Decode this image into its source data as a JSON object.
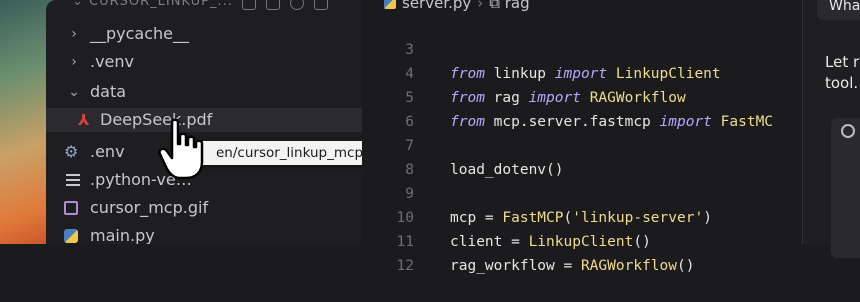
{
  "explorer": {
    "header_title": "CURSOR_LINKUP_...",
    "items": [
      {
        "label": "__pycache__",
        "type": "folder",
        "expanded": false
      },
      {
        "label": ".venv",
        "type": "folder",
        "expanded": false
      },
      {
        "label": "data",
        "type": "folder",
        "expanded": true
      },
      {
        "label": "DeepSeek.pdf",
        "type": "pdf",
        "selected": true
      },
      {
        "label": ".env",
        "type": "env"
      },
      {
        "label": ".python-ve…",
        "type": "text"
      },
      {
        "label": "cursor_mcp.gif",
        "type": "image"
      },
      {
        "label": "main.py",
        "type": "python"
      }
    ]
  },
  "tooltip": {
    "text": "en/cursor_linkup_mcp/data/DeepSeek.pdf"
  },
  "editor": {
    "tab_file": "server.py",
    "tab_symbol": "rag",
    "lines": [
      {
        "n": "3",
        "kw1": "from",
        "mod": " linkup ",
        "kw2": "import",
        "name": " LinkupClient"
      },
      {
        "n": "4",
        "kw1": "from",
        "mod": " rag ",
        "kw2": "import",
        "name": " RAGWorkflow"
      },
      {
        "n": "5",
        "kw1": "from",
        "mod": " mcp.server.fastmcp ",
        "kw2": "import",
        "name": " FastMC"
      },
      {
        "n": "6"
      },
      {
        "n": "7",
        "code": "load_dotenv()"
      },
      {
        "n": "8"
      },
      {
        "n": "9",
        "code_a": "mcp = ",
        "fn": "FastMCP",
        "code_b": "(",
        "str": "'linkup-server'",
        "code_c": ")"
      },
      {
        "n": "10",
        "code_a": "client = ",
        "fn": "LinkupClient",
        "code_b": "()"
      },
      {
        "n": "11",
        "code_a": "rag_workflow = ",
        "fn": "RAGWorkflow",
        "code_b": "()"
      },
      {
        "n": "12"
      }
    ]
  },
  "chat": {
    "input_text": "Wha",
    "message_line1": "Let r",
    "message_line2": "tool."
  },
  "colors": {
    "keyword": "#b8a8ff",
    "string": "#f0dc8c",
    "pdf": "#e0443e",
    "background": "#1b1b1d"
  }
}
